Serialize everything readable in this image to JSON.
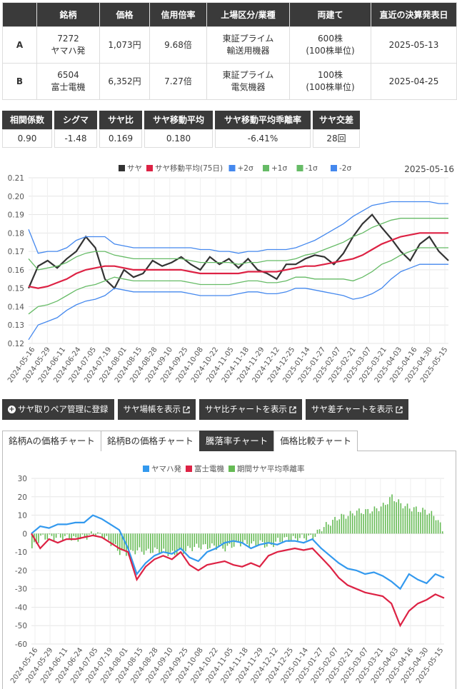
{
  "pair_table": {
    "headers": [
      "",
      "銘柄",
      "価格",
      "信用倍率",
      "上場区分/業種",
      "両建て",
      "直近の決算発表日"
    ],
    "rows": [
      {
        "label": "A",
        "code": "7272",
        "name": "ヤマハ発",
        "price": "1,073円",
        "margin_ratio": "9.68倍",
        "market": "東証プライム",
        "sector": "輸送用機器",
        "hedge": "600株",
        "hedge_unit": "(100株単位)",
        "earnings_date": "2025-05-13"
      },
      {
        "label": "B",
        "code": "6504",
        "name": "富士電機",
        "price": "6,352円",
        "margin_ratio": "7.27倍",
        "market": "東証プライム",
        "sector": "電気機器",
        "hedge": "100株",
        "hedge_unit": "(100株単位)",
        "earnings_date": "2025-04-25"
      }
    ]
  },
  "stats": [
    {
      "label": "相関係数",
      "value": "0.90"
    },
    {
      "label": "シグマ",
      "value": "-1.48"
    },
    {
      "label": "サヤ比",
      "value": "0.169"
    },
    {
      "label": "サヤ移動平均",
      "value": "0.180"
    },
    {
      "label": "サヤ移動平均乖離率",
      "value": "-6.41%"
    },
    {
      "label": "サヤ交差",
      "value": "28回"
    }
  ],
  "buttons": [
    {
      "label": "サヤ取りペア管理に登録",
      "icon": "plus-circle-icon"
    },
    {
      "label": "サヤ場帳を表示",
      "icon": "external-link-icon"
    },
    {
      "label": "サヤ比チャートを表示",
      "icon": "external-link-icon"
    },
    {
      "label": "サヤ差チャートを表示",
      "icon": "external-link-icon"
    }
  ],
  "tabs": [
    {
      "label": "銘柄Aの価格チャート",
      "active": false
    },
    {
      "label": "銘柄Bの価格チャート",
      "active": false
    },
    {
      "label": "騰落率チャート",
      "active": true
    },
    {
      "label": "価格比較チャート",
      "active": false
    }
  ],
  "chart_data": [
    {
      "type": "line",
      "date_label": "2025-05-16",
      "legend": [
        {
          "name": "サヤ",
          "color": "#333333"
        },
        {
          "name": "サヤ移動平均(75日)",
          "color": "#dd2244"
        },
        {
          "name": "+2σ",
          "color": "#4488ee"
        },
        {
          "name": "+1σ",
          "color": "#66bb66"
        },
        {
          "name": "-1σ",
          "color": "#66bb66"
        },
        {
          "name": "-2σ",
          "color": "#4488ee"
        }
      ],
      "legend_position": "top",
      "ylim": [
        0.12,
        0.21
      ],
      "yticks": [
        "0.21",
        "0.20",
        "0.19",
        "0.18",
        "0.17",
        "0.16",
        "0.15",
        "0.14",
        "0.13",
        "0.12"
      ],
      "x_ticks": [
        "2024-05-16",
        "2024-05-29",
        "2024-06-11",
        "2024-06-24",
        "2024-07-05",
        "2024-07-19",
        "2024-08-01",
        "2024-08-15",
        "2024-08-28",
        "2024-09-10",
        "2024-09-25",
        "2024-10-08",
        "2024-10-22",
        "2024-11-05",
        "2024-11-18",
        "2024-11-29",
        "2024-12-12",
        "2024-12-25",
        "2025-01-14",
        "2025-01-27",
        "2025-02-07",
        "2025-02-21",
        "2025-03-07",
        "2025-03-21",
        "2025-04-03",
        "2025-04-16",
        "2025-04-30",
        "2025-05-15"
      ],
      "grid": true,
      "series": [
        {
          "name": "サヤ",
          "values": [
            0.15,
            0.162,
            0.165,
            0.161,
            0.166,
            0.17,
            0.178,
            0.172,
            0.155,
            0.15,
            0.16,
            0.156,
            0.158,
            0.165,
            0.162,
            0.164,
            0.167,
            0.163,
            0.16,
            0.167,
            0.163,
            0.166,
            0.161,
            0.166,
            0.16,
            0.158,
            0.155,
            0.163,
            0.163,
            0.166,
            0.168,
            0.167,
            0.163,
            0.169,
            0.178,
            0.185,
            0.19,
            0.183,
            0.177,
            0.17,
            0.165,
            0.174,
            0.178,
            0.17,
            0.165
          ]
        },
        {
          "name": "サヤ移動平均(75日)",
          "values": [
            0.151,
            0.15,
            0.151,
            0.153,
            0.155,
            0.158,
            0.16,
            0.161,
            0.162,
            0.162,
            0.161,
            0.16,
            0.16,
            0.16,
            0.16,
            0.16,
            0.16,
            0.159,
            0.158,
            0.158,
            0.158,
            0.158,
            0.158,
            0.159,
            0.159,
            0.159,
            0.159,
            0.16,
            0.161,
            0.162,
            0.162,
            0.163,
            0.164,
            0.165,
            0.166,
            0.168,
            0.171,
            0.174,
            0.176,
            0.178,
            0.179,
            0.18,
            0.18,
            0.18,
            0.18
          ]
        },
        {
          "name": "+2σ",
          "values": [
            0.182,
            0.169,
            0.17,
            0.17,
            0.172,
            0.176,
            0.178,
            0.178,
            0.178,
            0.174,
            0.173,
            0.172,
            0.172,
            0.172,
            0.172,
            0.172,
            0.172,
            0.172,
            0.171,
            0.171,
            0.17,
            0.17,
            0.169,
            0.17,
            0.17,
            0.171,
            0.171,
            0.171,
            0.172,
            0.174,
            0.176,
            0.179,
            0.182,
            0.185,
            0.189,
            0.192,
            0.195,
            0.196,
            0.197,
            0.197,
            0.197,
            0.197,
            0.197,
            0.196,
            0.196
          ]
        },
        {
          "name": "+1σ",
          "values": [
            0.166,
            0.16,
            0.161,
            0.162,
            0.164,
            0.167,
            0.169,
            0.17,
            0.17,
            0.168,
            0.167,
            0.166,
            0.166,
            0.166,
            0.166,
            0.166,
            0.166,
            0.165,
            0.164,
            0.164,
            0.164,
            0.164,
            0.163,
            0.164,
            0.164,
            0.165,
            0.165,
            0.165,
            0.166,
            0.168,
            0.169,
            0.171,
            0.173,
            0.175,
            0.178,
            0.18,
            0.183,
            0.185,
            0.187,
            0.188,
            0.188,
            0.188,
            0.188,
            0.188,
            0.188
          ]
        },
        {
          "name": "-1σ",
          "values": [
            0.136,
            0.14,
            0.141,
            0.143,
            0.146,
            0.149,
            0.151,
            0.152,
            0.154,
            0.156,
            0.155,
            0.154,
            0.154,
            0.154,
            0.154,
            0.154,
            0.154,
            0.153,
            0.152,
            0.152,
            0.152,
            0.152,
            0.153,
            0.154,
            0.154,
            0.153,
            0.153,
            0.154,
            0.156,
            0.156,
            0.155,
            0.155,
            0.155,
            0.155,
            0.154,
            0.156,
            0.159,
            0.163,
            0.165,
            0.168,
            0.17,
            0.172,
            0.172,
            0.172,
            0.172
          ]
        },
        {
          "name": "-2σ",
          "values": [
            0.122,
            0.13,
            0.132,
            0.134,
            0.138,
            0.141,
            0.143,
            0.144,
            0.146,
            0.15,
            0.149,
            0.148,
            0.148,
            0.148,
            0.148,
            0.148,
            0.148,
            0.147,
            0.146,
            0.146,
            0.146,
            0.146,
            0.147,
            0.148,
            0.148,
            0.147,
            0.147,
            0.148,
            0.15,
            0.15,
            0.149,
            0.148,
            0.147,
            0.146,
            0.144,
            0.145,
            0.147,
            0.15,
            0.155,
            0.159,
            0.161,
            0.163,
            0.163,
            0.163,
            0.163
          ]
        }
      ]
    },
    {
      "type": "line",
      "legend": [
        {
          "name": "ヤマハ発",
          "color": "#3399ee"
        },
        {
          "name": "富士電機",
          "color": "#dd2244"
        },
        {
          "name": "期間サヤ平均乖離率",
          "color": "#66bb55"
        }
      ],
      "legend_position": "top",
      "ylim": [
        -60,
        30
      ],
      "yticks": [
        "30",
        "20",
        "10",
        "0",
        "-10",
        "-20",
        "-30",
        "-40",
        "-50",
        "-60"
      ],
      "x_ticks": [
        "2024-05-16",
        "2024-05-29",
        "2024-06-11",
        "2024-06-24",
        "2024-07-05",
        "2024-07-19",
        "2024-08-01",
        "2024-08-15",
        "2024-08-28",
        "2024-09-10",
        "2024-09-25",
        "2024-10-08",
        "2024-10-22",
        "2024-11-05",
        "2024-11-18",
        "2024-11-29",
        "2024-12-12",
        "2024-12-25",
        "2025-01-14",
        "2025-01-27",
        "2025-02-07",
        "2025-02-21",
        "2025-03-07",
        "2025-03-21",
        "2025-04-03",
        "2025-04-16",
        "2025-04-30",
        "2025-05-15"
      ],
      "grid": true,
      "series": [
        {
          "name": "ヤマハ発",
          "values": [
            0,
            4,
            3,
            5,
            5,
            6,
            6,
            10,
            8,
            5,
            2,
            -8,
            -22,
            -16,
            -12,
            -10,
            -11,
            -8,
            -13,
            -15,
            -10,
            -8,
            -5,
            -4,
            -5,
            -8,
            -6,
            -5,
            -6,
            -4,
            -4,
            -5,
            -3,
            -8,
            -12,
            -16,
            -19,
            -20,
            -22,
            -21,
            -23,
            -26,
            -30,
            -22,
            -25,
            -27,
            -22,
            -24
          ]
        },
        {
          "name": "富士電機",
          "values": [
            0,
            -8,
            -3,
            -5,
            -3,
            -3,
            -2,
            -1,
            -2,
            -5,
            -8,
            -10,
            -25,
            -18,
            -14,
            -12,
            -14,
            -10,
            -17,
            -20,
            -17,
            -16,
            -15,
            -17,
            -18,
            -16,
            -18,
            -12,
            -10,
            -9,
            -8,
            -9,
            -8,
            -13,
            -18,
            -24,
            -28,
            -30,
            -32,
            -33,
            -34,
            -38,
            -50,
            -42,
            -38,
            -36,
            -33,
            -35
          ]
        },
        {
          "name": "期間サヤ平均乖離率",
          "values": [
            -8,
            -2,
            -2,
            -2,
            -2,
            -3,
            -2,
            0,
            -1,
            -5,
            -10,
            -11,
            -9,
            -10,
            -9,
            -10,
            -11,
            -10,
            -8,
            -7,
            -7,
            -7,
            -8,
            -6,
            -5,
            -6,
            -5,
            -7,
            -4,
            -3,
            -3,
            -2,
            -2,
            3,
            6,
            9,
            10,
            12,
            12,
            13,
            15,
            20,
            16,
            14,
            13,
            12,
            9,
            0
          ]
        }
      ]
    }
  ]
}
